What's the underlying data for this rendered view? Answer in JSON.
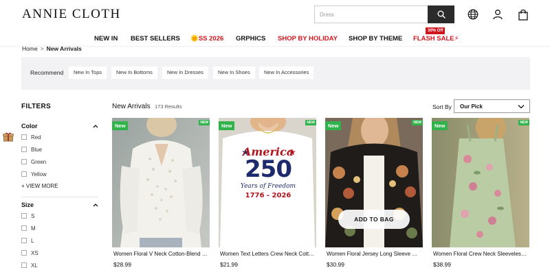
{
  "brand": {
    "logo": "ANNIE CLOTH"
  },
  "search": {
    "placeholder": "Dress"
  },
  "header_icons": [
    "globe-icon",
    "user-icon",
    "shopping-bag-icon"
  ],
  "nav": {
    "items": [
      "NEW IN",
      "BEST SELLERS",
      "🌞SS 2026",
      "GRPHICS",
      "SHOP BY HOLIDAY",
      "SHOP BY THEME",
      "FLASH SALE⚡"
    ],
    "flash_badge": "30% Off"
  },
  "breadcrumb": {
    "home": "Home",
    "separator": ">",
    "current": "New Arrivals"
  },
  "recommend": {
    "label": "Recommend",
    "tags": [
      "New In Tops",
      "New In Bottoms",
      "New In Dresses",
      "New In Shoes",
      "New In Accessories"
    ]
  },
  "filters": {
    "title": "FILTERS",
    "color": {
      "title": "Color",
      "options": [
        "Red",
        "Blue",
        "Green",
        "Yellow"
      ],
      "view_more": "+ VIEW MORE"
    },
    "size": {
      "title": "Size",
      "options": [
        "S",
        "M",
        "L",
        "XS",
        "XL"
      ]
    }
  },
  "results": {
    "title": "New Arrivals",
    "count": "173 Results"
  },
  "sort": {
    "label": "Sort By",
    "value": "Our Pick"
  },
  "products": [
    {
      "badge": "New",
      "badge_small": "NEW",
      "name": "Women Floral V Neck Cotton-Blend Long Sleeve Shirt",
      "price": "$28.99"
    },
    {
      "badge": "New",
      "badge_small": "NEW",
      "name": "Women Text Letters Crew Neck Cotton T-Shirt",
      "price": "$21.99",
      "print": {
        "line1": "America",
        "line2": "250",
        "line3": "Years of Freedom",
        "line4": "1776 - 2026"
      }
    },
    {
      "badge": "New",
      "badge_small": "NEW",
      "name": "Women Floral Jersey Long Sleeve Cardigan",
      "price": "$30.99",
      "button": "ADD TO BAG"
    },
    {
      "badge": "New",
      "badge_small": "NEW",
      "name": "Women Floral Crew Neck Sleeveless Jumpsuit",
      "price": "$38.99"
    }
  ],
  "colors": {
    "accent_red": "#d4141c",
    "new_badge": "#2fb34a",
    "search_button": "#2b2b2b",
    "recommend_bg": "#f2f2f4"
  }
}
